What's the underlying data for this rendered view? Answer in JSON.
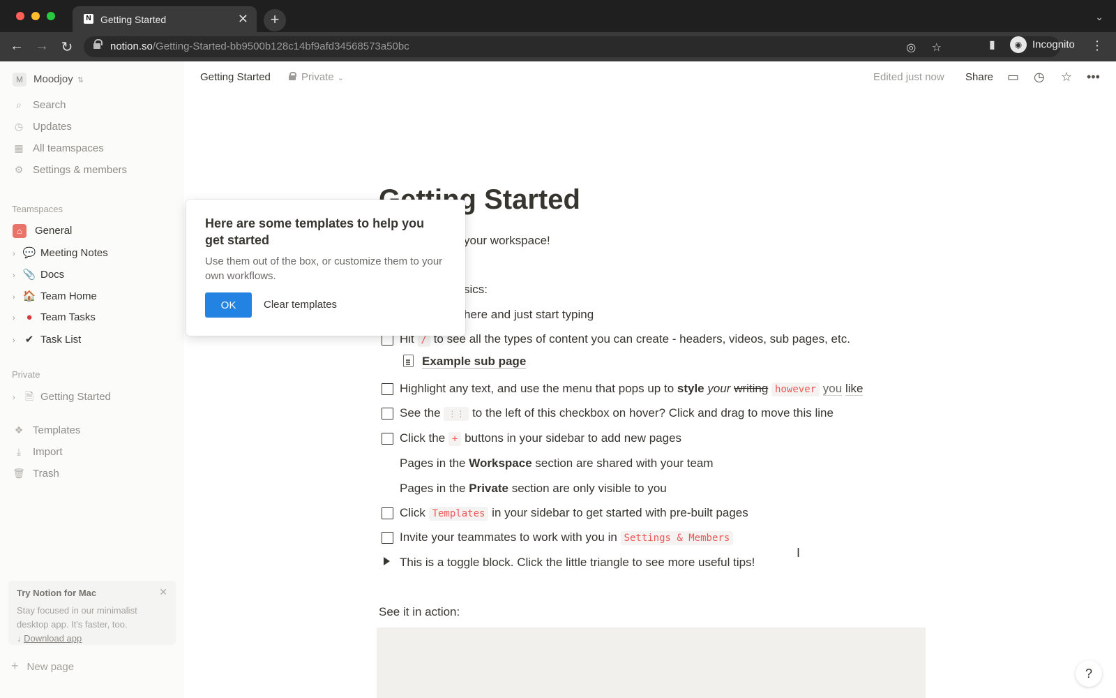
{
  "browser": {
    "tab_title": "Getting Started",
    "tab_close": "✕",
    "new_tab": "+",
    "url_host": "notion.so",
    "url_path": "/Getting-Started-bb9500b128c14bf9afd34568573a50bc",
    "incognito_label": "Incognito"
  },
  "sidebar": {
    "workspace_initial": "M",
    "workspace_name": "Moodjoy",
    "nav": [
      {
        "label": "Search",
        "icon": "search-icon"
      },
      {
        "label": "Updates",
        "icon": "clock-icon"
      },
      {
        "label": "All teamspaces",
        "icon": "building-icon"
      },
      {
        "label": "Settings & members",
        "icon": "gear-icon"
      }
    ],
    "teamspaces_heading": "Teamspaces",
    "teamspaces": [
      {
        "label": "General",
        "icon": "home-icon"
      },
      {
        "label": "Meeting Notes",
        "icon": "speech-bubble-icon"
      },
      {
        "label": "Docs",
        "icon": "paperclip-icon"
      },
      {
        "label": "Team Home",
        "icon": "house-icon"
      },
      {
        "label": "Team Tasks",
        "icon": "red-ball-icon"
      },
      {
        "label": "Task List",
        "icon": "checkmark-icon"
      }
    ],
    "private_heading": "Private",
    "private_pages": [
      {
        "label": "Getting Started",
        "icon": "page-icon"
      }
    ],
    "footer_nav": [
      {
        "label": "Templates",
        "icon": "templates-icon"
      },
      {
        "label": "Import",
        "icon": "download-icon"
      },
      {
        "label": "Trash",
        "icon": "trash-icon"
      }
    ],
    "promo": {
      "title": "Try Notion for Mac",
      "body": "Stay focused in our minimalist desktop app. It's faster, too.",
      "link": "Download app"
    },
    "new_page": "New page"
  },
  "topbar": {
    "breadcrumb": "Getting Started",
    "privacy": "Private",
    "edited": "Edited just now",
    "share": "Share"
  },
  "page": {
    "title": "Getting Started",
    "welcome_tail": "your workspace!",
    "basics_tail": "sics:",
    "typing_tail": "here and just start typing",
    "hit": {
      "pre": "Hit",
      "code": "/",
      "post": "to see all the types of content you can create - headers, videos, sub pages, etc."
    },
    "sub_page": "Example sub page",
    "highlight": {
      "pre": "Highlight any text, and use the menu that pops up to",
      "bold": "style",
      "italic": "your",
      "strike": "writing",
      "code": "however",
      "you": "you",
      "like": "like"
    },
    "see": {
      "pre": "See the",
      "code": "⋮⋮",
      "post": "to the left of this checkbox on hover? Click and drag to move this line"
    },
    "click_plus": {
      "pre": "Click the",
      "code": "+",
      "post": "buttons in your sidebar to add new pages"
    },
    "workspace_line": {
      "pre": "Pages in the",
      "bold": "Workspace",
      "post": "section are shared with your team"
    },
    "private_line": {
      "pre": "Pages in the",
      "bold": "Private",
      "post": "section are only visible to you"
    },
    "templates_line": {
      "pre": "Click",
      "code": "Templates",
      "post": "in your sidebar to get started with pre-built pages"
    },
    "invite_line": {
      "pre": "Invite your teammates to work with you in",
      "code": "Settings & Members"
    },
    "toggle_line": "This is a toggle block. Click the little triangle to see more useful tips!",
    "see_action": "See it in action:"
  },
  "popup": {
    "title": "Here are some templates to help you get started",
    "body": "Use them out of the box, or customize them to your own workflows.",
    "ok": "OK",
    "clear": "Clear templates"
  },
  "help": "?",
  "colors": {
    "accent": "#2383e2",
    "code_red": "#eb5757"
  }
}
